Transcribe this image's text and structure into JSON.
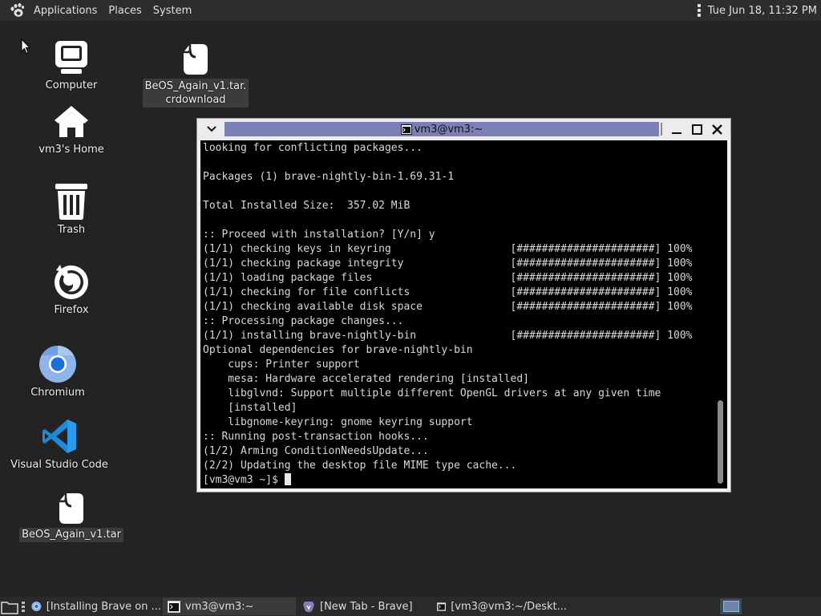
{
  "top_panel": {
    "menus": [
      "Applications",
      "Places",
      "System"
    ],
    "clock": "Tue Jun 18, 11:32 PM"
  },
  "desktop": {
    "icons": [
      {
        "label": "Computer",
        "icon": "computer-icon"
      },
      {
        "label": "BeOS_Again_v1.tar.\ncrdownload",
        "icon": "file-icon"
      },
      {
        "label": "vm3's Home",
        "icon": "home-icon"
      },
      {
        "label": "Trash",
        "icon": "trash-icon"
      },
      {
        "label": "Firefox",
        "icon": "firefox-icon"
      },
      {
        "label": "Chromium",
        "icon": "chromium-icon"
      },
      {
        "label": "Visual Studio Code",
        "icon": "vscode-icon"
      },
      {
        "label": "BeOS_Again_v1.tar",
        "icon": "file-icon"
      }
    ]
  },
  "terminal": {
    "title": "vm3@vm3:~",
    "lines": [
      "looking for conflicting packages...",
      "",
      "Packages (1) brave-nightly-bin-1.69.31-1",
      "",
      "Total Installed Size:  357.02 MiB",
      "",
      ":: Proceed with installation? [Y/n] y",
      "(1/1) checking keys in keyring                   [######################] 100%",
      "(1/1) checking package integrity                 [######################] 100%",
      "(1/1) loading package files                      [######################] 100%",
      "(1/1) checking for file conflicts                [######################] 100%",
      "(1/1) checking available disk space              [######################] 100%",
      ":: Processing package changes...",
      "(1/1) installing brave-nightly-bin               [######################] 100%",
      "Optional dependencies for brave-nightly-bin",
      "    cups: Printer support",
      "    mesa: Hardware accelerated rendering [installed]",
      "    libglvnd: Support multiple different OpenGL drivers at any given time",
      "    [installed]",
      "    libgnome-keyring: gnome keyring support",
      ":: Running post-transaction hooks...",
      "(1/2) Arming ConditionNeedsUpdate...",
      "(2/2) Updating the desktop file MIME type cache..."
    ],
    "prompt": "[vm3@vm3 ~]$ "
  },
  "taskbar": {
    "tasks": [
      {
        "label": "[Installing Brave on ...",
        "icon": "chromium-icon"
      },
      {
        "label": "vm3@vm3:~",
        "icon": "terminal-icon"
      },
      {
        "label": "[New Tab - Brave]",
        "icon": "brave-icon"
      },
      {
        "label": "[vm3@vm3:~/Deskt...",
        "icon": "terminal-icon"
      }
    ]
  }
}
